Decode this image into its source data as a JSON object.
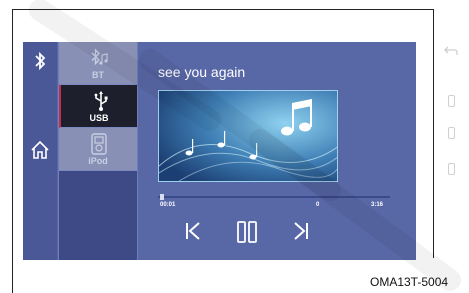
{
  "sources": {
    "bt_label": "BT",
    "usb_label": "USB",
    "ipod_label": "iPod",
    "active": "USB"
  },
  "player": {
    "track_title": "see you again",
    "elapsed": "00:01",
    "middle_value": "0",
    "total": "3:16",
    "progress_fraction": 0.01
  },
  "ref_code": "OMA13T-5004",
  "icons": {
    "left_top": "bluetooth-icon",
    "left_bottom": "home-icon",
    "bt": "bluetooth-audio-icon",
    "usb": "usb-icon",
    "ipod": "ipod-icon",
    "prev": "previous-track-icon",
    "pause": "pause-icon",
    "next": "next-track-icon",
    "right_back": "back-icon"
  },
  "colors": {
    "screen_bg": "#5867a6",
    "active_tab": "#1d1f2c",
    "active_marker": "#c0304b"
  }
}
